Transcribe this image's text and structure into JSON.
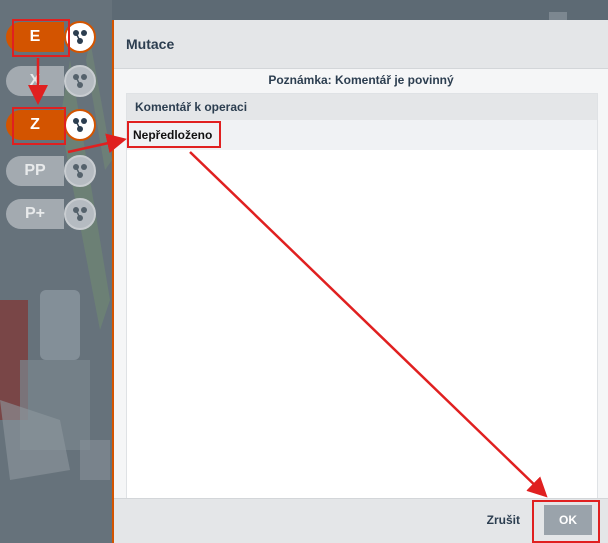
{
  "operations": [
    {
      "code": "E",
      "state": "active"
    },
    {
      "code": "X",
      "state": "inactive"
    },
    {
      "code": "Z",
      "state": "active"
    },
    {
      "code": "PP",
      "state": "inactive"
    },
    {
      "code": "P+",
      "state": "inactive"
    }
  ],
  "dialog": {
    "title": "Mutace",
    "note": "Poznámka: Komentář je povinný",
    "comment_header": "Komentář k operaci",
    "comment_value": "Nepředloženo",
    "cancel_label": "Zrušit",
    "ok_label": "OK"
  },
  "colors": {
    "accent": "#d35400",
    "highlight": "#e02020",
    "ok_button": "#9aa3ab"
  },
  "icons": {
    "operation_icon": "workflow-nodes-icon"
  }
}
